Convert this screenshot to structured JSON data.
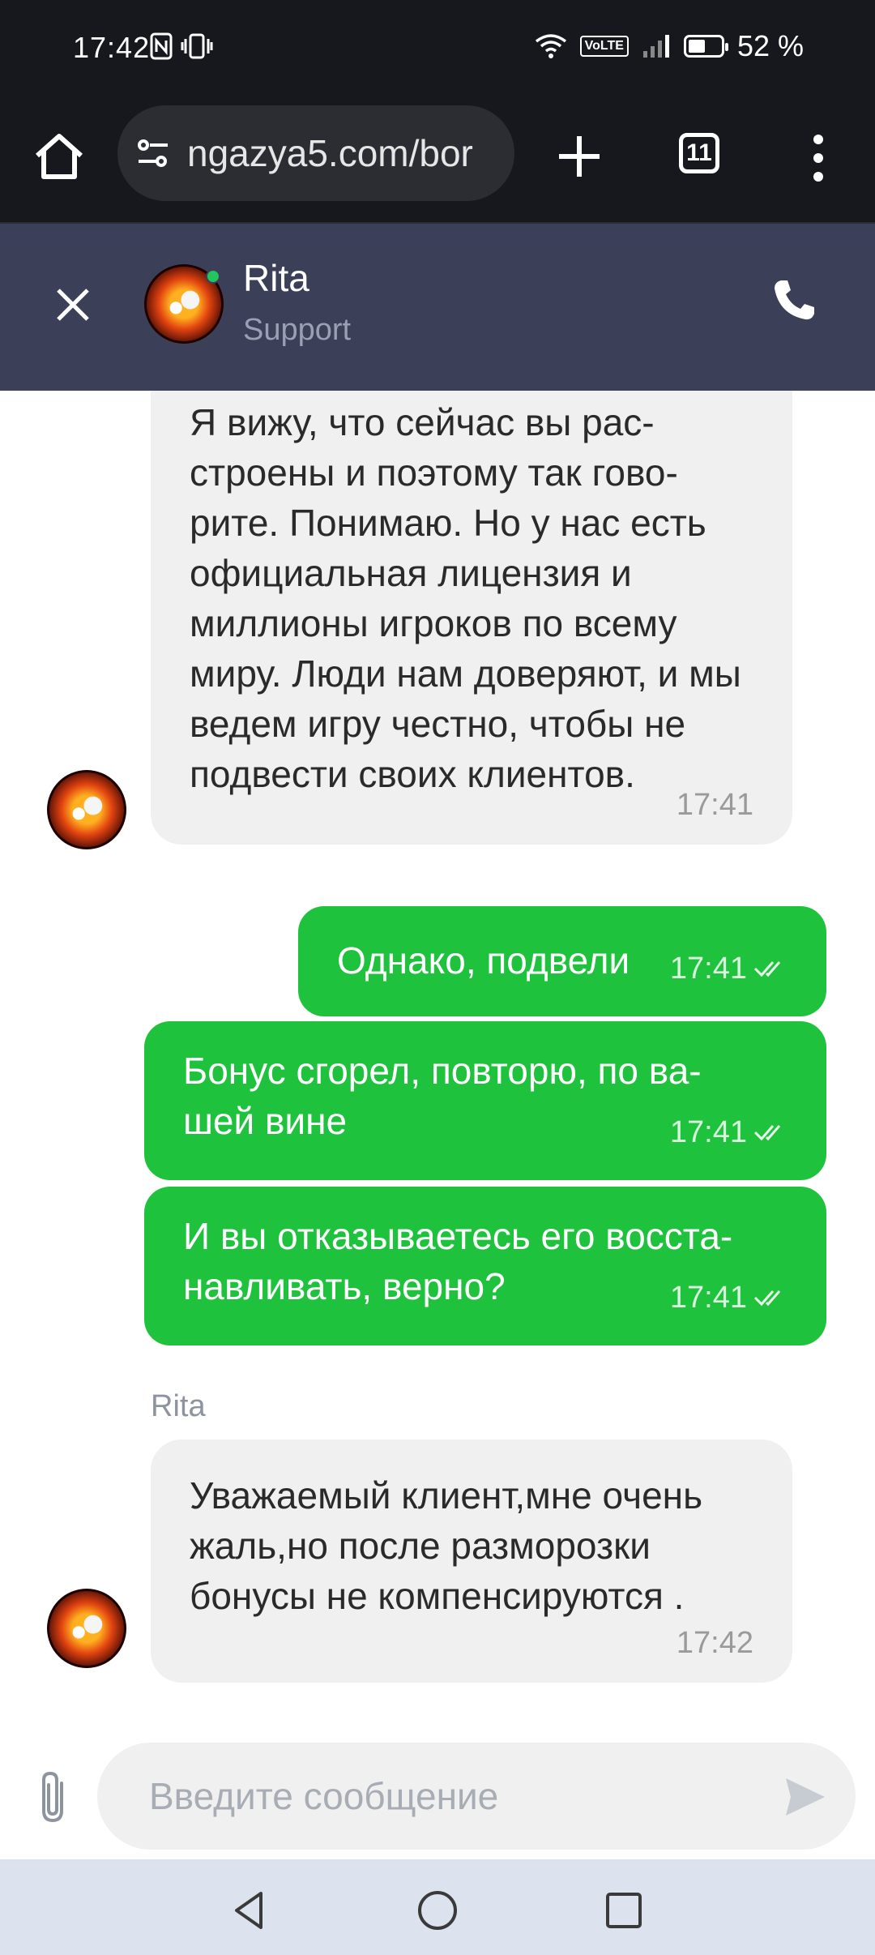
{
  "status_bar": {
    "time": "17:42",
    "volte": "VoLTE",
    "battery_text": "52 %",
    "battery_level": 0.52
  },
  "browser": {
    "url": "ngazya5.com/bor",
    "tab_count": "11"
  },
  "chat_header": {
    "agent_name": "Rita",
    "agent_role": "Support",
    "online": true
  },
  "messages": [
    {
      "side": "in",
      "text": "Я вижу, что сейчас вы рас-строены и поэтому так гово-рите. Понимаю. Но у нас есть официальная лицензия и миллионы игроков по всему миру. Люди нам доверяют, и мы ведем игру честно, чтобы не подвести своих клиентов.",
      "time": "17:41"
    },
    {
      "side": "out",
      "text": "Однако, подвели",
      "time": "17:41"
    },
    {
      "side": "out",
      "text": "Бонус сгорел, повторю, по ва-шей вине",
      "time": "17:41"
    },
    {
      "side": "out",
      "text": "И вы отказываетесь его восста-навливать, верно?",
      "time": "17:41"
    },
    {
      "side": "in",
      "sender": "Rita",
      "text": "Уважаемый клиент,мне очень жаль,но после   разморозки бонусы не компенсируются .",
      "time": "17:42"
    }
  ],
  "composer": {
    "placeholder": "Введите сообщение"
  },
  "colors": {
    "header_bg": "#3b3f58",
    "outgoing_bubble": "#1fc23d",
    "incoming_bubble": "#f0f0f0",
    "online": "#22c55e"
  },
  "icons": [
    "home-icon",
    "site-info-icon",
    "plus-icon",
    "more-icon",
    "close-icon",
    "phone-icon",
    "double-check-icon",
    "paperclip-icon",
    "send-icon",
    "back-icon",
    "home-circle-icon",
    "recents-icon"
  ]
}
